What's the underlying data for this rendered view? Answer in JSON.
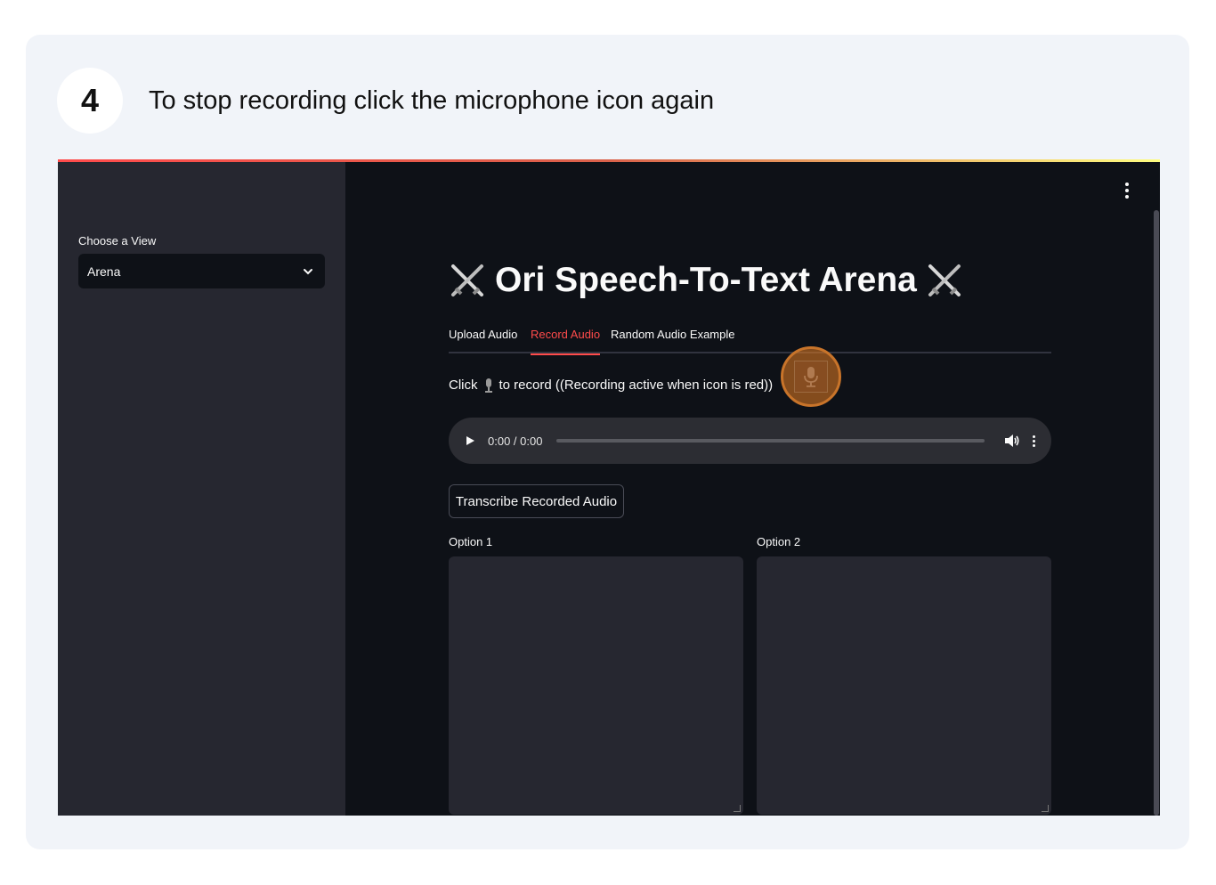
{
  "step": {
    "number": "4",
    "instruction": "To stop recording click the microphone icon again"
  },
  "app": {
    "sidebar": {
      "label": "Choose a View",
      "selected": "Arena"
    },
    "title": "Ori Speech-To-Text Arena",
    "tabs": [
      {
        "label": "Upload Audio",
        "active": false
      },
      {
        "label": "Record Audio",
        "active": true
      },
      {
        "label": "Random Audio Example",
        "active": false
      }
    ],
    "record_prompt_before": "Click",
    "record_prompt_after": "to record ((Recording active when icon is red))",
    "audio": {
      "time": "0:00 / 0:00"
    },
    "transcribe_button": "Transcribe Recorded Audio",
    "option1_label": "Option 1",
    "option2_label": "Option 2",
    "colors": {
      "accent": "#ff4b4b",
      "background": "#0e1117",
      "sidebar": "#262730",
      "highlight": "#e67e22"
    },
    "icons": [
      "crossed-swords-icon",
      "microphone-icon",
      "chevron-down-icon",
      "play-icon",
      "volume-icon",
      "kebab-menu-icon"
    ]
  }
}
